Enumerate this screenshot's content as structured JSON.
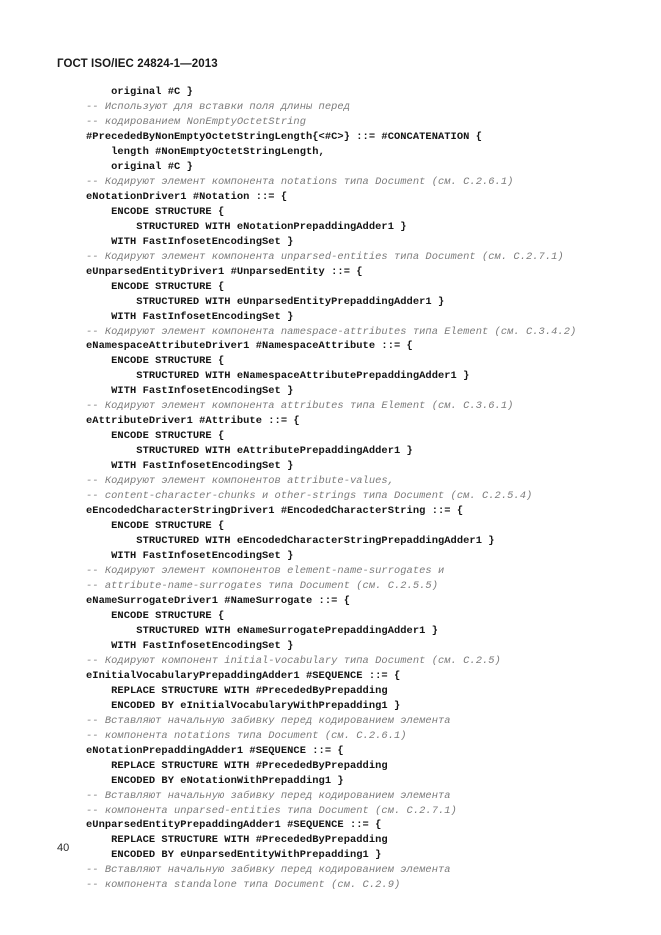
{
  "document": {
    "running_head": "ГОСТ ISO/IEC 24824-1—2013",
    "page_number": "40",
    "colors": {
      "code_text": "#141414",
      "comment_text": "#7b7b7b",
      "header_text": "#1a1a1a",
      "page_background": "#ffffff"
    }
  },
  "code_listing": {
    "lines": [
      {
        "kind": "code",
        "text": "    original #C }"
      },
      {
        "kind": "comment",
        "text": "-- Используют для вставки поля длины перед"
      },
      {
        "kind": "comment",
        "text": "-- кодированием NonEmptyOctetString"
      },
      {
        "kind": "code",
        "text": "#PrecededByNonEmptyOctetStringLength{<#C>} ::= #CONCATENATION {"
      },
      {
        "kind": "code",
        "text": "    length #NonEmptyOctetStringLength,"
      },
      {
        "kind": "code",
        "text": "    original #C }"
      },
      {
        "kind": "comment",
        "text": "-- Кодируют элемент компонента notations типа Document (см. C.2.6.1)"
      },
      {
        "kind": "code",
        "text": "eNotationDriver1 #Notation ::= {"
      },
      {
        "kind": "code",
        "text": "    ENCODE STRUCTURE {"
      },
      {
        "kind": "code",
        "text": "        STRUCTURED WITH eNotationPrepaddingAdder1 }"
      },
      {
        "kind": "code",
        "text": "    WITH FastInfosetEncodingSet }"
      },
      {
        "kind": "comment",
        "text": "-- Кодируют элемент компонента unparsed-entities типа Document (см. C.2.7.1)"
      },
      {
        "kind": "code",
        "text": "eUnparsedEntityDriver1 #UnparsedEntity ::= {"
      },
      {
        "kind": "code",
        "text": "    ENCODE STRUCTURE {"
      },
      {
        "kind": "code",
        "text": "        STRUCTURED WITH eUnparsedEntityPrepaddingAdder1 }"
      },
      {
        "kind": "code",
        "text": "    WITH FastInfosetEncodingSet }"
      },
      {
        "kind": "comment",
        "text": "-- Кодируют элемент компонента namespace-attributes типа Element (см. C.3.4.2)"
      },
      {
        "kind": "code",
        "text": "eNamespaceAttributeDriver1 #NamespaceAttribute ::= {"
      },
      {
        "kind": "code",
        "text": "    ENCODE STRUCTURE {"
      },
      {
        "kind": "code",
        "text": "        STRUCTURED WITH eNamespaceAttributePrepaddingAdder1 }"
      },
      {
        "kind": "code",
        "text": "    WITH FastInfosetEncodingSet }"
      },
      {
        "kind": "comment",
        "text": "-- Кодируют элемент компонента attributes типа Element (см. C.3.6.1)"
      },
      {
        "kind": "code",
        "text": "eAttributeDriver1 #Attribute ::= {"
      },
      {
        "kind": "code",
        "text": "    ENCODE STRUCTURE {"
      },
      {
        "kind": "code",
        "text": "        STRUCTURED WITH eAttributePrepaddingAdder1 }"
      },
      {
        "kind": "code",
        "text": "    WITH FastInfosetEncodingSet }"
      },
      {
        "kind": "comment",
        "text": "-- Кодируют элемент компонентов attribute-values,"
      },
      {
        "kind": "comment",
        "text": "-- content-character-chunks и other-strings типа Document (см. C.2.5.4)"
      },
      {
        "kind": "code",
        "text": "eEncodedCharacterStringDriver1 #EncodedCharacterString ::= {"
      },
      {
        "kind": "code",
        "text": "    ENCODE STRUCTURE {"
      },
      {
        "kind": "code",
        "text": "        STRUCTURED WITH eEncodedCharacterStringPrepaddingAdder1 }"
      },
      {
        "kind": "code",
        "text": "    WITH FastInfosetEncodingSet }"
      },
      {
        "kind": "comment",
        "text": "-- Кодируют элемент компонентов element-name-surrogates и"
      },
      {
        "kind": "comment",
        "text": "-- attribute-name-surrogates типа Document (см. C.2.5.5)"
      },
      {
        "kind": "code",
        "text": "eNameSurrogateDriver1 #NameSurrogate ::= {"
      },
      {
        "kind": "code",
        "text": "    ENCODE STRUCTURE {"
      },
      {
        "kind": "code",
        "text": "        STRUCTURED WITH eNameSurrogatePrepaddingAdder1 }"
      },
      {
        "kind": "code",
        "text": "    WITH FastInfosetEncodingSet }"
      },
      {
        "kind": "comment",
        "text": "-- Кодируют компонент initial-vocabulary типа Document (см. C.2.5)"
      },
      {
        "kind": "code",
        "text": "eInitialVocabularyPrepaddingAdder1 #SEQUENCE ::= {"
      },
      {
        "kind": "code",
        "text": "    REPLACE STRUCTURE WITH #PrecededByPrepadding"
      },
      {
        "kind": "code",
        "text": "    ENCODED BY eInitialVocabularyWithPrepadding1 }"
      },
      {
        "kind": "comment",
        "text": "-- Вставляют начальную забивку перед кодированием элемента"
      },
      {
        "kind": "comment",
        "text": "-- компонента notations типа Document (см. C.2.6.1)"
      },
      {
        "kind": "code",
        "text": "eNotationPrepaddingAdder1 #SEQUENCE ::= {"
      },
      {
        "kind": "code",
        "text": "    REPLACE STRUCTURE WITH #PrecededByPrepadding"
      },
      {
        "kind": "code",
        "text": "    ENCODED BY eNotationWithPrepadding1 }"
      },
      {
        "kind": "comment",
        "text": "-- Вставляют начальную забивку перед кодированием элемента"
      },
      {
        "kind": "comment",
        "text": "-- компонента unparsed-entities типа Document (см. C.2.7.1)"
      },
      {
        "kind": "code",
        "text": "eUnparsedEntityPrepaddingAdder1 #SEQUENCE ::= {"
      },
      {
        "kind": "code",
        "text": "    REPLACE STRUCTURE WITH #PrecededByPrepadding"
      },
      {
        "kind": "code",
        "text": "    ENCODED BY eUnparsedEntityWithPrepadding1 }"
      },
      {
        "kind": "comment",
        "text": "-- Вставляют начальную забивку перед кодированием элемента"
      },
      {
        "kind": "comment",
        "text": "-- компонента standalone типа Document (см. C.2.9)"
      }
    ]
  }
}
